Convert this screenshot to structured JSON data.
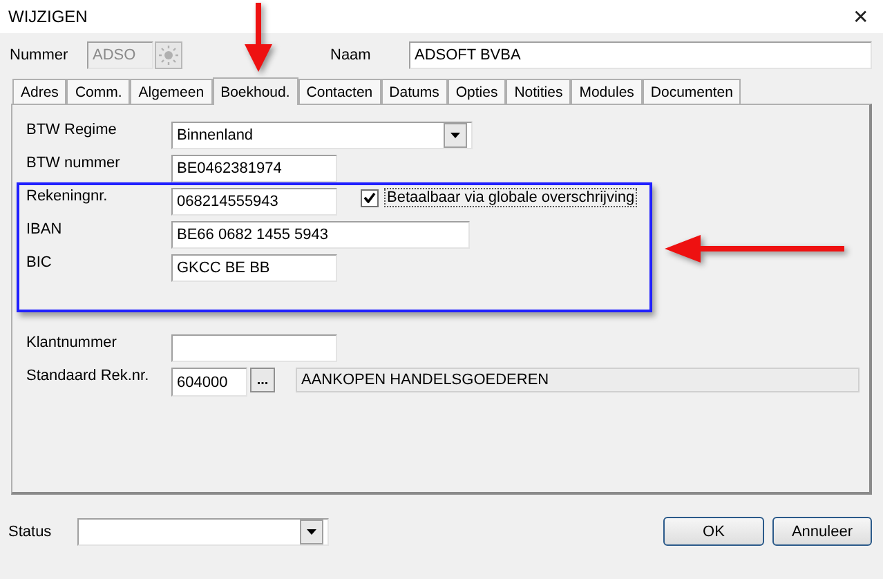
{
  "window": {
    "title": "WIJZIGEN",
    "close": "✕"
  },
  "header": {
    "number_label": "Nummer",
    "number_value": "ADSO",
    "number_disabled": true,
    "name_label": "Naam",
    "name_value": "ADSOFT BVBA"
  },
  "tabs": [
    {
      "label": "Adres",
      "selected": false
    },
    {
      "label": "Comm.",
      "selected": false
    },
    {
      "label": "Algemeen",
      "selected": false
    },
    {
      "label": "Boekhoud.",
      "selected": true
    },
    {
      "label": "Contacten",
      "selected": false
    },
    {
      "label": "Datums",
      "selected": false
    },
    {
      "label": "Opties",
      "selected": false
    },
    {
      "label": "Notities",
      "selected": false
    },
    {
      "label": "Modules",
      "selected": false
    },
    {
      "label": "Documenten",
      "selected": false
    }
  ],
  "groups": [
    {
      "fields": [
        {
          "kind": "combo",
          "label": "BTW Regime",
          "value": "Binnenland"
        },
        {
          "kind": "text",
          "label": "BTW nummer",
          "value": "BE0462381974"
        },
        {
          "kind": "text",
          "label": "Rekeningnr.",
          "value": "068214555943",
          "checkbox": {
            "label": "Betaalbaar via globale overschrijving",
            "checked": true
          }
        },
        {
          "kind": "longtext",
          "label": "IBAN",
          "value": "BE66 0682 1455 5943"
        },
        {
          "kind": "text",
          "label": "BIC",
          "value": "GKCC BE BB"
        }
      ]
    },
    {
      "fields": [
        {
          "kind": "text",
          "label": "Klantnummer"
        },
        {
          "kind": "lookup",
          "label": "Standaard Rek.nr.",
          "value": "604000",
          "button": "...",
          "description": "AANKOPEN HANDELSGOEDEREN"
        }
      ]
    }
  ],
  "footer": {
    "status_label": "Status",
    "buttons": [
      "OK",
      "Annuleer"
    ]
  }
}
